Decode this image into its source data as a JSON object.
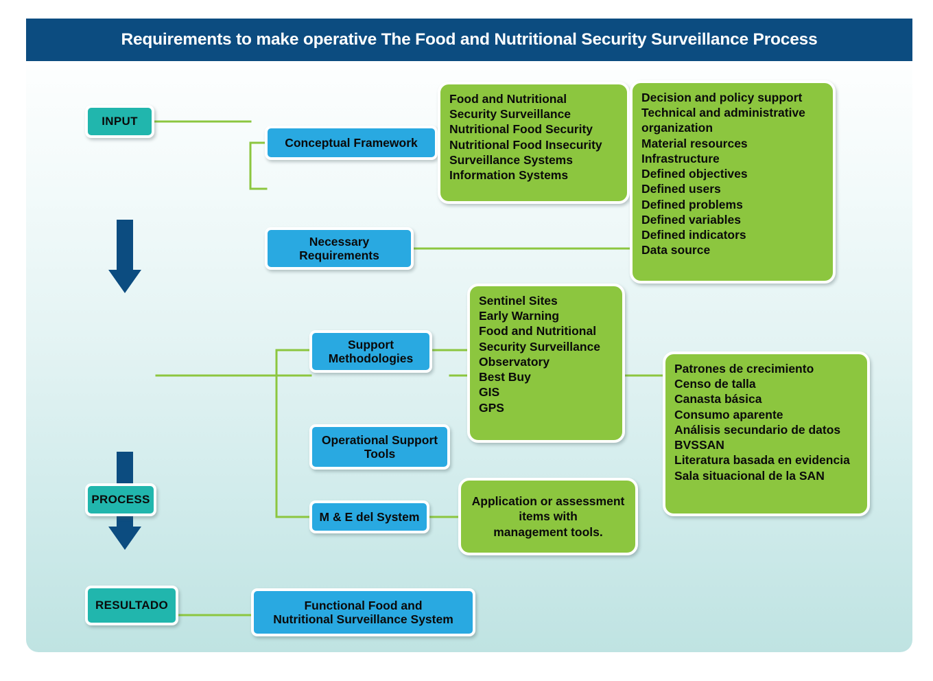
{
  "header": {
    "title": "Requirements to make operative The Food and Nutritional Security Surveillance Process"
  },
  "colors": {
    "header_bar": "#0c4c80",
    "stage_node": "#21b6ad",
    "blue_node": "#29a9e1",
    "green_node": "#8cc63f",
    "connector_line": "#8cc63f",
    "arrow": "#0c4c80",
    "canvas_top": "#fdfefe",
    "canvas_bottom": "#bfe3e2"
  },
  "stages": {
    "input": "INPUT",
    "process": "PROCESS",
    "resultado": "RESULTADO"
  },
  "blue_nodes": {
    "conceptual_framework": "Conceptual Framework",
    "necessary_requirements": "Necessary\nRequirements",
    "necessary_requirements_line1": "Necessary",
    "necessary_requirements_line2": "Requirements",
    "support_methodologies_line1": "Support",
    "support_methodologies_line2": "Methodologies",
    "operational_support_tools_line1": "Operational Support",
    "operational_support_tools_line2": "Tools",
    "me_del_system": "M & E del System",
    "functional_system_line1": "Functional Food and",
    "functional_system_line2": "Nutritional Surveillance System"
  },
  "green_boxes": {
    "conceptual_framework_items": [
      "Food and Nutritional",
      "Security Surveillance",
      "Nutritional Food Security",
      "Nutritional Food Insecurity",
      "Surveillance Systems",
      "Information Systems"
    ],
    "necessary_requirements_items": [
      "Decision and policy support",
      "Technical and administrative",
      "organization",
      "Material resources",
      "Infrastructure",
      "Defined objectives",
      "Defined users",
      "Defined problems",
      "Defined variables",
      "Defined indicators",
      "Data source"
    ],
    "support_methodologies_items": [
      "Sentinel Sites",
      "Early Warning",
      "Food and Nutritional",
      "Security Surveillance",
      "Observatory",
      "Best Buy",
      "GIS",
      "GPS"
    ],
    "operational_support_tools_items": [
      "Patrones de crecimiento",
      "Censo de talla",
      "Canasta básica",
      "Consumo aparente",
      "Análisis secundario de datos",
      "BVSSAN",
      "Literatura basada en evidencia",
      "Sala situacional de la SAN"
    ],
    "me_del_system_items": [
      "Application or assessment",
      "items with",
      "management tools."
    ]
  }
}
